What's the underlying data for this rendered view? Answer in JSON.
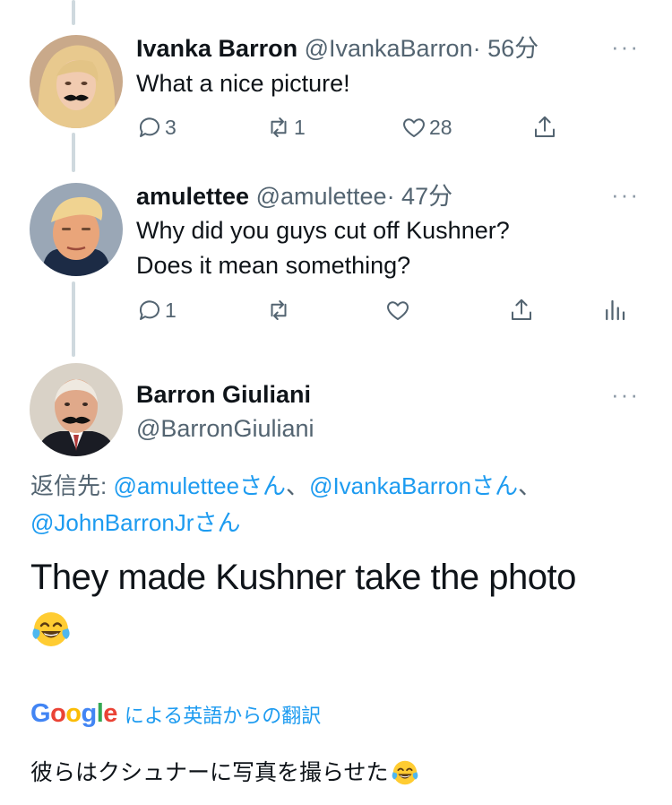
{
  "tweets": [
    {
      "name": "Ivanka Barron",
      "handle": "@IvankaBarron",
      "time": "· 56分",
      "text": "What a nice picture!",
      "replies": "3",
      "retweets": "1",
      "likes": "28"
    },
    {
      "name": "amulettee",
      "handle": "@amulettee",
      "time": "· 47分",
      "text_lines": [
        "Why did you guys cut off Kushner?",
        "Does it mean something?"
      ],
      "replies": "1"
    }
  ],
  "main_tweet": {
    "name": "Barron Giuliani",
    "handle": "@BarronGiuliani",
    "reply_prefix": "返信先: ",
    "reply_to": [
      "@amulettee",
      "@IvankaBarron",
      "@JohnBarronJr"
    ],
    "reply_suffix": "さん",
    "reply_sep": "、",
    "text_line1": "They made Kushner take the photo",
    "emoji": "face-with-tears-of-joy",
    "translate_label": "による英語からの翻訳",
    "google_letters": [
      "G",
      "o",
      "o",
      "g",
      "l",
      "e"
    ],
    "translation_text": "彼らはクシュナーに写真を撮らせた"
  },
  "more_glyph": "···",
  "colors": {
    "link": "#1d9bf0",
    "muted": "#536471",
    "thread_line": "#cfd9de",
    "google": [
      "#4285f4",
      "#ea4335",
      "#fbbc05",
      "#4285f4",
      "#34a853",
      "#ea4335"
    ]
  },
  "icons": [
    "reply-icon",
    "retweet-icon",
    "like-icon",
    "share-icon",
    "analytics-icon",
    "more-icon"
  ]
}
